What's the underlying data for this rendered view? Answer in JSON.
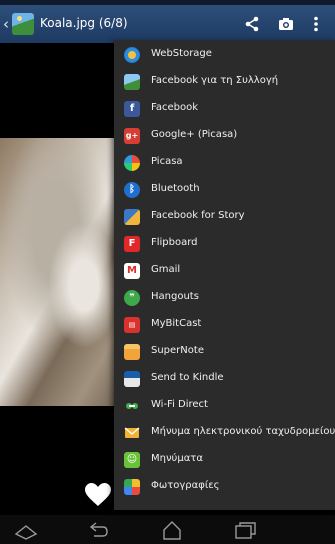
{
  "action_bar": {
    "title": "Koala.jpg (6/8)",
    "back_icon": "chevron-left-icon",
    "thumbnail_icon": "gallery-thumbnail-icon",
    "actions": [
      "share-icon",
      "camera-icon",
      "overflow-menu-icon"
    ]
  },
  "share_menu": {
    "items": [
      {
        "label": "WebStorage",
        "icon": "webstorage-icon",
        "color": "#2b8de0"
      },
      {
        "label": "Facebook για τη Συλλογή",
        "icon": "gallery-icon",
        "color": "#58a5d8"
      },
      {
        "label": "Facebook",
        "icon": "facebook-icon",
        "color": "#3b5998"
      },
      {
        "label": "Google+ (Picasa)",
        "icon": "google-plus-icon",
        "color": "#d73d32"
      },
      {
        "label": "Picasa",
        "icon": "picasa-icon",
        "color": "#e8a33b"
      },
      {
        "label": "Bluetooth",
        "icon": "bluetooth-icon",
        "color": "#1f6fd1"
      },
      {
        "label": "Facebook for Story",
        "icon": "story-icon",
        "color": "#3b78c6"
      },
      {
        "label": "Flipboard",
        "icon": "flipboard-icon",
        "color": "#e12828"
      },
      {
        "label": "Gmail",
        "icon": "gmail-icon",
        "color": "#ffffff"
      },
      {
        "label": "Hangouts",
        "icon": "hangouts-icon",
        "color": "#3fa84a"
      },
      {
        "label": "MyBitCast",
        "icon": "mybitcast-icon",
        "color": "#d9322c"
      },
      {
        "label": "SuperNote",
        "icon": "supernote-icon",
        "color": "#f1a43a"
      },
      {
        "label": "Send to Kindle",
        "icon": "kindle-icon",
        "color": "#1a5da8"
      },
      {
        "label": "Wi-Fi Direct",
        "icon": "wifi-direct-icon",
        "color": "#3a3a3a"
      },
      {
        "label": "Μήνυμα ηλεκτρονικού ταχυδρομείου",
        "icon": "email-icon",
        "color": "#f2b233"
      },
      {
        "label": "Μηνύματα",
        "icon": "messages-icon",
        "color": "#6ac238"
      },
      {
        "label": "Φωτογραφίες",
        "icon": "photos-icon",
        "color": "#f0c030"
      }
    ]
  },
  "bottom_bar": {
    "favorite_icon": "heart-icon"
  },
  "nav_bar": {
    "buttons": [
      "home-screen-icon",
      "back-icon",
      "home-icon",
      "recent-apps-icon"
    ]
  }
}
